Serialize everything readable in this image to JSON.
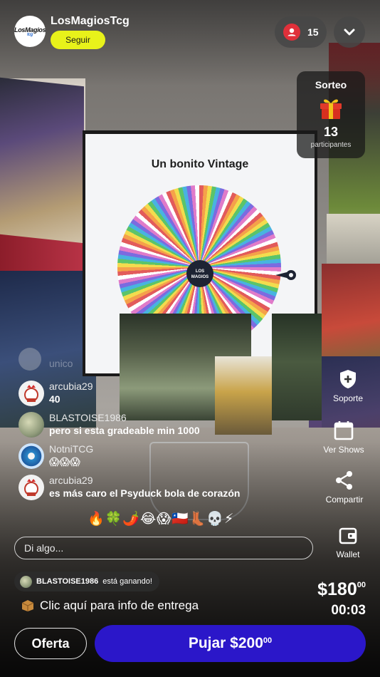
{
  "host": {
    "name": "LosMagiosTcg",
    "avatar_text": "LosMagios",
    "avatar_sub": "tcg",
    "follow_label": "Seguir"
  },
  "viewers": {
    "count": "15"
  },
  "raffle": {
    "title": "Sorteo",
    "count": "13",
    "subtitle": "participantes"
  },
  "stream": {
    "screen_title": "Un bonito Vintage",
    "wheel_center": "LOS MAGIOS"
  },
  "actions": [
    {
      "label": "Soporte",
      "icon": "shield-plus-icon"
    },
    {
      "label": "Ver Shows",
      "icon": "calendar-icon"
    },
    {
      "label": "Compartir",
      "icon": "share-icon"
    },
    {
      "label": "Wallet",
      "icon": "wallet-icon"
    }
  ],
  "chat": {
    "faded_text": "unico",
    "messages": [
      {
        "user": "arcubia29",
        "text": "40"
      },
      {
        "user": "BLASTOISE1986",
        "text": "pero si esta gradeable min 1000"
      },
      {
        "user": "NotniTCG",
        "text": "😱😱😱"
      },
      {
        "user": "arcubia29",
        "text": "es más caro el Psyduck bola de corazón"
      }
    ],
    "reactions": "🔥🍀🌶️😂😱🇨🇱👢💀⚡"
  },
  "input": {
    "placeholder": "Di algo..."
  },
  "auction": {
    "winner_name": "BLASTOISE1986",
    "winner_text": "está ganando!",
    "price": "$180",
    "price_cents": "00",
    "timer": "00:03",
    "delivery_text": "Clic aquí para info de entrega"
  },
  "buttons": {
    "offer_label": "Oferta",
    "bid_label": "Pujar $200",
    "bid_cents": "00"
  },
  "colors": {
    "follow": "#e8f21a",
    "bid_button": "#2b17c9",
    "viewer_dot": "#e0303a"
  }
}
